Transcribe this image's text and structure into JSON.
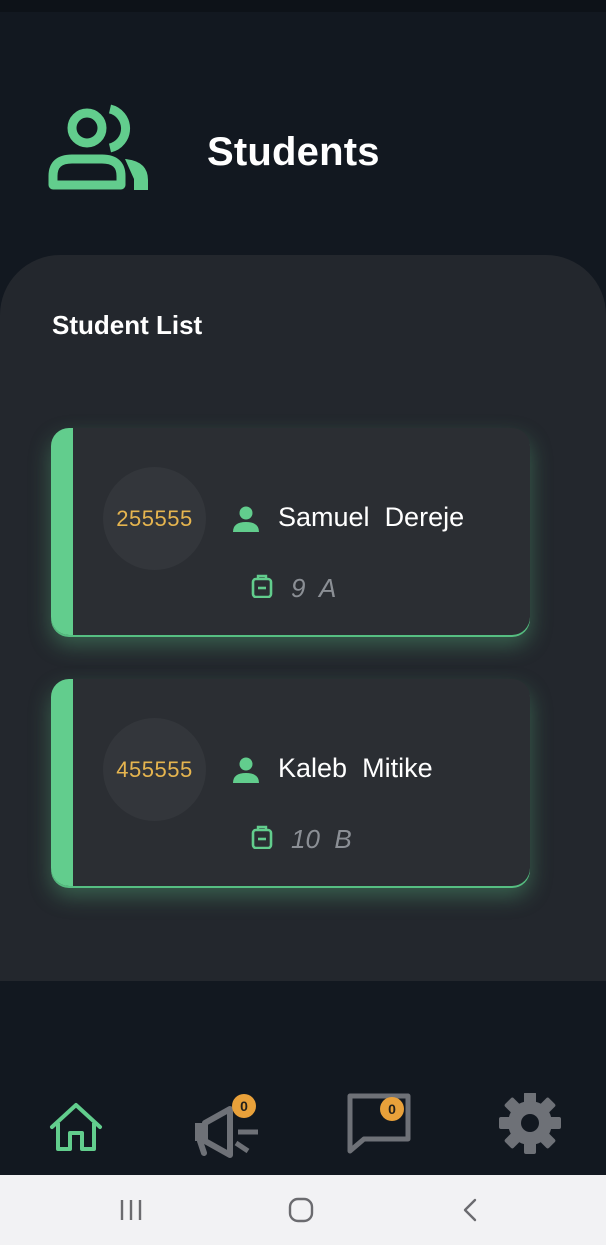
{
  "header": {
    "title": "Students",
    "icon": "group-icon"
  },
  "list": {
    "title": "Student List",
    "students": [
      {
        "id": "255555",
        "first_name": "Samuel",
        "last_name": "Dereje",
        "grade": "9",
        "section": "A"
      },
      {
        "id": "455555",
        "first_name": "Kaleb",
        "last_name": "Mitike",
        "grade": "10",
        "section": "B"
      }
    ]
  },
  "nav": {
    "items": [
      {
        "name": "home",
        "icon": "home-icon",
        "active": true
      },
      {
        "name": "announcements",
        "icon": "megaphone-icon",
        "badge": "0"
      },
      {
        "name": "messages",
        "icon": "chat-icon",
        "badge": "0"
      },
      {
        "name": "settings",
        "icon": "gear-icon"
      }
    ]
  },
  "colors": {
    "background": "#121820",
    "panel": "#23272d",
    "card": "#2b2e33",
    "accent": "#62cd8d",
    "id_text": "#e6b54f",
    "muted": "#8b8f95",
    "badge": "#e9a13a"
  }
}
